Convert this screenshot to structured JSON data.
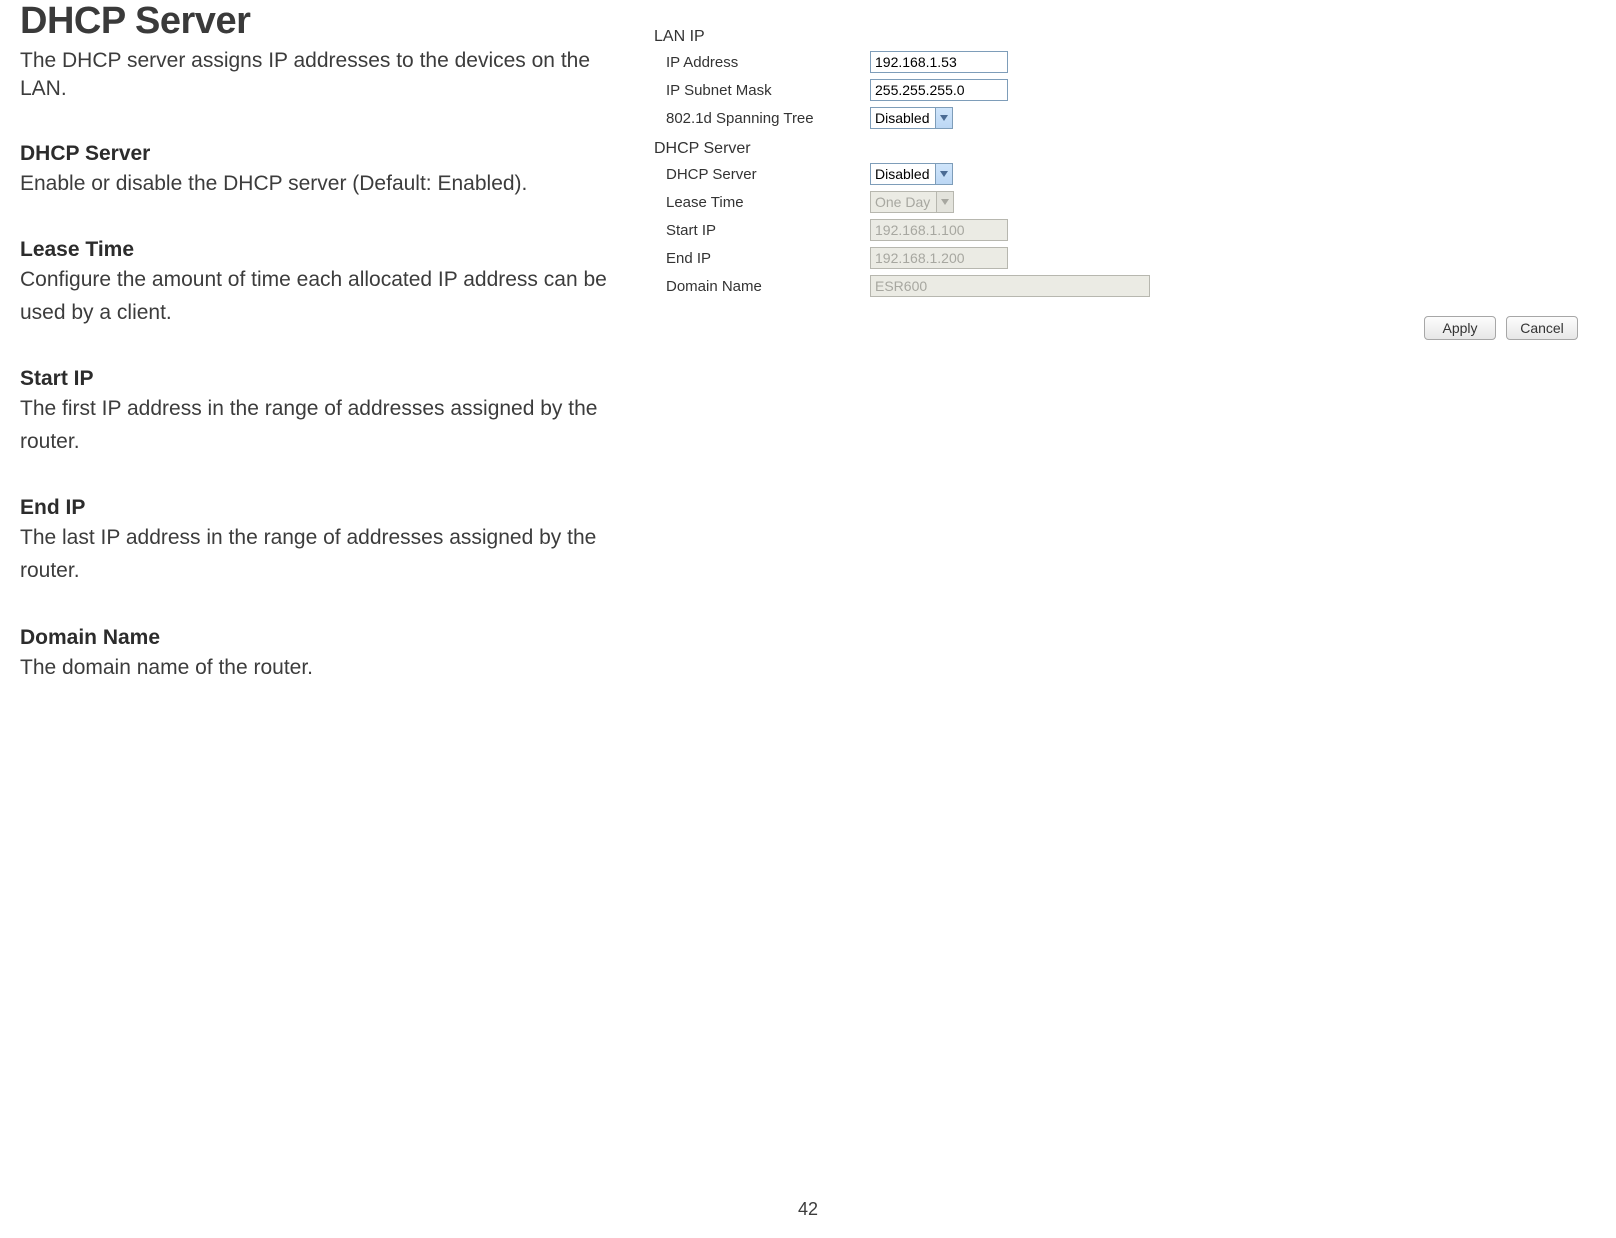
{
  "doc": {
    "title": "DHCP Server",
    "intro": "The DHCP server assigns IP addresses to the devices on the LAN.",
    "sections": [
      {
        "heading": "DHCP Server",
        "body": "Enable or disable the DHCP server (Default: Enabled)."
      },
      {
        "heading": "Lease Time",
        "body": "Configure the amount of time each allocated IP address can be used by a client."
      },
      {
        "heading": "Start IP",
        "body": "The first IP address in the range of addresses assigned by the router."
      },
      {
        "heading": "End IP",
        "body": "The last IP address in the range of addresses assigned by the router."
      },
      {
        "heading": "Domain Name",
        "body": "The domain name of the router."
      }
    ],
    "page_number": "42"
  },
  "panel": {
    "lan_ip": {
      "title": "LAN IP",
      "ip_address_label": "IP Address",
      "ip_address_value": "192.168.1.53",
      "subnet_label": "IP Subnet Mask",
      "subnet_value": "255.255.255.0",
      "spanning_label": "802.1d Spanning Tree",
      "spanning_value": "Disabled"
    },
    "dhcp": {
      "title": "DHCP Server",
      "server_label": "DHCP Server",
      "server_value": "Disabled",
      "lease_label": "Lease Time",
      "lease_value": "One Day",
      "start_label": "Start IP",
      "start_value": "192.168.1.100",
      "end_label": "End IP",
      "end_value": "192.168.1.200",
      "domain_label": "Domain Name",
      "domain_value": "ESR600"
    },
    "buttons": {
      "apply": "Apply",
      "cancel": "Cancel"
    }
  }
}
